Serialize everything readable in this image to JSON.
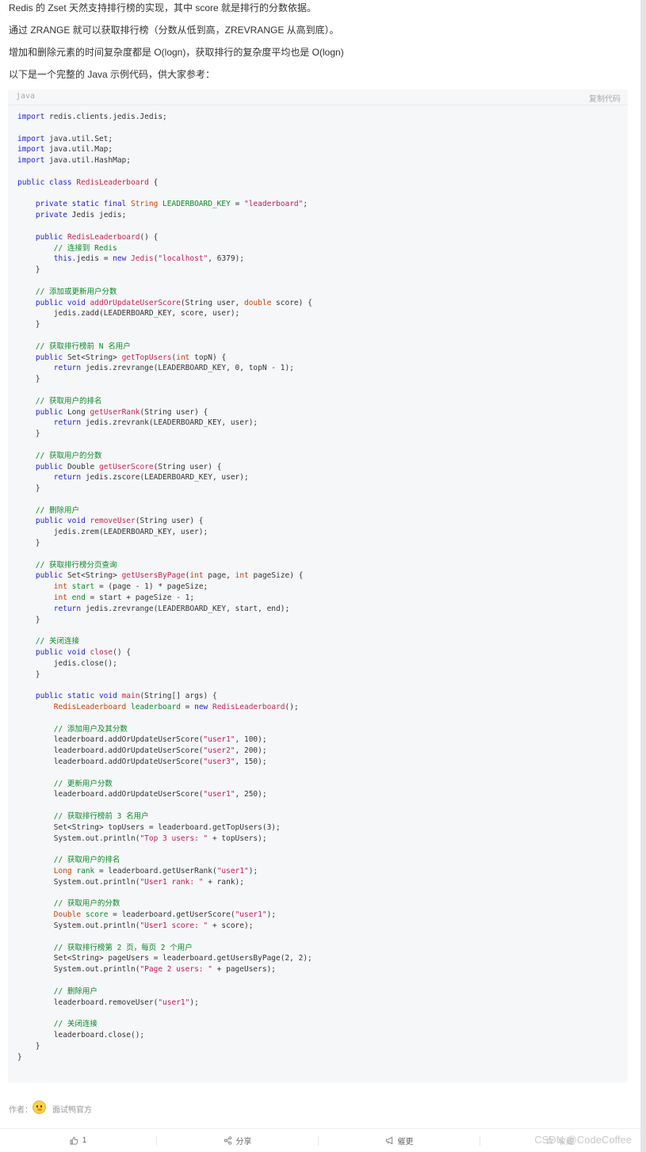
{
  "intro": {
    "p1": "Redis 的 Zset 天然支持排行榜的实现，其中 score 就是排行的分数依据。",
    "p2": "通过 ZRANGE 就可以获取排行榜（分数从低到高，ZREVRANGE 从高到底）。",
    "p3": "增加和删除元素的时间复杂度都是 O(logn)，获取排行的复杂度平均也是 O(logn)",
    "p4": "以下是一个完整的 Java 示例代码，供大家参考："
  },
  "code_block": {
    "language": "java",
    "copy_label": "复制代码",
    "lines": [
      [
        [
          "kw",
          "import"
        ],
        [
          "p",
          " redis.clients.jedis.Jedis;"
        ]
      ],
      [],
      [
        [
          "kw",
          "import"
        ],
        [
          "p",
          " java.util.Set;"
        ]
      ],
      [
        [
          "kw",
          "import"
        ],
        [
          "p",
          " java.util.Map;"
        ]
      ],
      [
        [
          "kw",
          "import"
        ],
        [
          "p",
          " java.util.HashMap;"
        ]
      ],
      [],
      [
        [
          "kw",
          "public class "
        ],
        [
          "fn",
          "RedisLeaderboard"
        ],
        [
          "p",
          " {"
        ]
      ],
      [],
      [
        [
          "p",
          "    "
        ],
        [
          "kw",
          "private static final "
        ],
        [
          "type",
          "String "
        ],
        [
          "var",
          "LEADERBOARD_KEY"
        ],
        [
          "p",
          " = "
        ],
        [
          "str",
          "\"leaderboard\""
        ],
        [
          "p",
          ";"
        ]
      ],
      [
        [
          "p",
          "    "
        ],
        [
          "kw",
          "private "
        ],
        [
          "p",
          "Jedis jedis;"
        ]
      ],
      [],
      [
        [
          "p",
          "    "
        ],
        [
          "kw",
          "public "
        ],
        [
          "fn",
          "RedisLeaderboard"
        ],
        [
          "p",
          "() {"
        ]
      ],
      [
        [
          "p",
          "        "
        ],
        [
          "com",
          "// 连接到 Redis"
        ]
      ],
      [
        [
          "p",
          "        "
        ],
        [
          "kw",
          "this"
        ],
        [
          "p",
          ".jedis = "
        ],
        [
          "kw",
          "new "
        ],
        [
          "fn",
          "Jedis"
        ],
        [
          "p",
          "("
        ],
        [
          "str",
          "\"localhost\""
        ],
        [
          "p",
          ", 6379);"
        ]
      ],
      [
        [
          "p",
          "    }"
        ]
      ],
      [],
      [
        [
          "p",
          "    "
        ],
        [
          "com",
          "// 添加或更新用户分数"
        ]
      ],
      [
        [
          "p",
          "    "
        ],
        [
          "kw",
          "public void "
        ],
        [
          "fn",
          "addOrUpdateUserScore"
        ],
        [
          "p",
          "(String user, "
        ],
        [
          "type",
          "double"
        ],
        [
          "p",
          " score) {"
        ]
      ],
      [
        [
          "p",
          "        jedis.zadd(LEADERBOARD_KEY, score, user);"
        ]
      ],
      [
        [
          "p",
          "    }"
        ]
      ],
      [],
      [
        [
          "p",
          "    "
        ],
        [
          "com",
          "// 获取排行榜前 N 名用户"
        ]
      ],
      [
        [
          "p",
          "    "
        ],
        [
          "kw",
          "public "
        ],
        [
          "p",
          "Set<String> "
        ],
        [
          "fn",
          "getTopUsers"
        ],
        [
          "p",
          "("
        ],
        [
          "type",
          "int"
        ],
        [
          "p",
          " topN) {"
        ]
      ],
      [
        [
          "p",
          "        "
        ],
        [
          "kw",
          "return "
        ],
        [
          "p",
          "jedis.zrevrange(LEADERBOARD_KEY, 0, topN - 1);"
        ]
      ],
      [
        [
          "p",
          "    }"
        ]
      ],
      [],
      [
        [
          "p",
          "    "
        ],
        [
          "com",
          "// 获取用户的排名"
        ]
      ],
      [
        [
          "p",
          "    "
        ],
        [
          "kw",
          "public "
        ],
        [
          "p",
          "Long "
        ],
        [
          "fn",
          "getUserRank"
        ],
        [
          "p",
          "(String user) {"
        ]
      ],
      [
        [
          "p",
          "        "
        ],
        [
          "kw",
          "return "
        ],
        [
          "p",
          "jedis.zrevrank(LEADERBOARD_KEY, user);"
        ]
      ],
      [
        [
          "p",
          "    }"
        ]
      ],
      [],
      [
        [
          "p",
          "    "
        ],
        [
          "com",
          "// 获取用户的分数"
        ]
      ],
      [
        [
          "p",
          "    "
        ],
        [
          "kw",
          "public "
        ],
        [
          "p",
          "Double "
        ],
        [
          "fn",
          "getUserScore"
        ],
        [
          "p",
          "(String user) {"
        ]
      ],
      [
        [
          "p",
          "        "
        ],
        [
          "kw",
          "return "
        ],
        [
          "p",
          "jedis.zscore(LEADERBOARD_KEY, user);"
        ]
      ],
      [
        [
          "p",
          "    }"
        ]
      ],
      [],
      [
        [
          "p",
          "    "
        ],
        [
          "com",
          "// 删除用户"
        ]
      ],
      [
        [
          "p",
          "    "
        ],
        [
          "kw",
          "public void "
        ],
        [
          "fn",
          "removeUser"
        ],
        [
          "p",
          "(String user) {"
        ]
      ],
      [
        [
          "p",
          "        jedis.zrem(LEADERBOARD_KEY, user);"
        ]
      ],
      [
        [
          "p",
          "    }"
        ]
      ],
      [],
      [
        [
          "p",
          "    "
        ],
        [
          "com",
          "// 获取排行榜分页查询"
        ]
      ],
      [
        [
          "p",
          "    "
        ],
        [
          "kw",
          "public "
        ],
        [
          "p",
          "Set<String> "
        ],
        [
          "fn",
          "getUsersByPage"
        ],
        [
          "p",
          "("
        ],
        [
          "type",
          "int"
        ],
        [
          "p",
          " page, "
        ],
        [
          "type",
          "int"
        ],
        [
          "p",
          " pageSize) {"
        ]
      ],
      [
        [
          "p",
          "        "
        ],
        [
          "type",
          "int "
        ],
        [
          "var",
          "start"
        ],
        [
          "p",
          " = (page - 1) * pageSize;"
        ]
      ],
      [
        [
          "p",
          "        "
        ],
        [
          "type",
          "int "
        ],
        [
          "var",
          "end"
        ],
        [
          "p",
          " = start + pageSize - 1;"
        ]
      ],
      [
        [
          "p",
          "        "
        ],
        [
          "kw",
          "return "
        ],
        [
          "p",
          "jedis.zrevrange(LEADERBOARD_KEY, start, end);"
        ]
      ],
      [
        [
          "p",
          "    }"
        ]
      ],
      [],
      [
        [
          "p",
          "    "
        ],
        [
          "com",
          "// 关闭连接"
        ]
      ],
      [
        [
          "p",
          "    "
        ],
        [
          "kw",
          "public void "
        ],
        [
          "fn",
          "close"
        ],
        [
          "p",
          "() {"
        ]
      ],
      [
        [
          "p",
          "        jedis.close();"
        ]
      ],
      [
        [
          "p",
          "    }"
        ]
      ],
      [],
      [
        [
          "p",
          "    "
        ],
        [
          "kw",
          "public static void "
        ],
        [
          "fn",
          "main"
        ],
        [
          "p",
          "(String[] args) {"
        ]
      ],
      [
        [
          "p",
          "        "
        ],
        [
          "type",
          "RedisLeaderboard "
        ],
        [
          "var",
          "leaderboard"
        ],
        [
          "p",
          " = "
        ],
        [
          "kw",
          "new "
        ],
        [
          "fn",
          "RedisLeaderboard"
        ],
        [
          "p",
          "();"
        ]
      ],
      [],
      [
        [
          "p",
          "        "
        ],
        [
          "com",
          "// 添加用户及其分数"
        ]
      ],
      [
        [
          "p",
          "        leaderboard.addOrUpdateUserScore("
        ],
        [
          "str",
          "\"user1\""
        ],
        [
          "p",
          ", 100);"
        ]
      ],
      [
        [
          "p",
          "        leaderboard.addOrUpdateUserScore("
        ],
        [
          "str",
          "\"user2\""
        ],
        [
          "p",
          ", 200);"
        ]
      ],
      [
        [
          "p",
          "        leaderboard.addOrUpdateUserScore("
        ],
        [
          "str",
          "\"user3\""
        ],
        [
          "p",
          ", 150);"
        ]
      ],
      [],
      [
        [
          "p",
          "        "
        ],
        [
          "com",
          "// 更新用户分数"
        ]
      ],
      [
        [
          "p",
          "        leaderboard.addOrUpdateUserScore("
        ],
        [
          "str",
          "\"user1\""
        ],
        [
          "p",
          ", 250);"
        ]
      ],
      [],
      [
        [
          "p",
          "        "
        ],
        [
          "com",
          "// 获取排行榜前 3 名用户"
        ]
      ],
      [
        [
          "p",
          "        Set<String> topUsers = leaderboard.getTopUsers(3);"
        ]
      ],
      [
        [
          "p",
          "        System.out.println("
        ],
        [
          "str",
          "\"Top 3 users: \""
        ],
        [
          "p",
          " + topUsers);"
        ]
      ],
      [],
      [
        [
          "p",
          "        "
        ],
        [
          "com",
          "// 获取用户的排名"
        ]
      ],
      [
        [
          "p",
          "        "
        ],
        [
          "type",
          "Long "
        ],
        [
          "var",
          "rank"
        ],
        [
          "p",
          " = leaderboard.getUserRank("
        ],
        [
          "str",
          "\"user1\""
        ],
        [
          "p",
          ");"
        ]
      ],
      [
        [
          "p",
          "        System.out.println("
        ],
        [
          "str",
          "\"User1 rank: \""
        ],
        [
          "p",
          " + rank);"
        ]
      ],
      [],
      [
        [
          "p",
          "        "
        ],
        [
          "com",
          "// 获取用户的分数"
        ]
      ],
      [
        [
          "p",
          "        "
        ],
        [
          "type",
          "Double "
        ],
        [
          "var",
          "score"
        ],
        [
          "p",
          " = leaderboard.getUserScore("
        ],
        [
          "str",
          "\"user1\""
        ],
        [
          "p",
          ");"
        ]
      ],
      [
        [
          "p",
          "        System.out.println("
        ],
        [
          "str",
          "\"User1 score: \""
        ],
        [
          "p",
          " + score);"
        ]
      ],
      [],
      [
        [
          "p",
          "        "
        ],
        [
          "com",
          "// 获取排行榜第 2 页，每页 2 个用户"
        ]
      ],
      [
        [
          "p",
          "        Set<String> pageUsers = leaderboard.getUsersByPage(2, 2);"
        ]
      ],
      [
        [
          "p",
          "        System.out.println("
        ],
        [
          "str",
          "\"Page 2 users: \""
        ],
        [
          "p",
          " + pageUsers);"
        ]
      ],
      [],
      [
        [
          "p",
          "        "
        ],
        [
          "com",
          "// 删除用户"
        ]
      ],
      [
        [
          "p",
          "        leaderboard.removeUser("
        ],
        [
          "str",
          "\"user1\""
        ],
        [
          "p",
          ");"
        ]
      ],
      [],
      [
        [
          "p",
          "        "
        ],
        [
          "com",
          "// 关闭连接"
        ]
      ],
      [
        [
          "p",
          "        leaderboard.close();"
        ]
      ],
      [
        [
          "p",
          "    }"
        ]
      ],
      [
        [
          "p",
          "}"
        ]
      ]
    ]
  },
  "author": {
    "label": "作者：",
    "name": "面试鸭官方",
    "avatar_icon": "duck-avatar"
  },
  "actions": {
    "like_count": "1",
    "share_label": "分享",
    "urge_label": "催更",
    "fourth_label": "收藏"
  },
  "watermark": "CSDN @CodeCoffee",
  "colors": {
    "code_bg": "#f6f7f8",
    "keyword": "#1f1fd6",
    "function": "#c7254e",
    "string": "#c2185b",
    "comment": "#0b8a2a"
  }
}
